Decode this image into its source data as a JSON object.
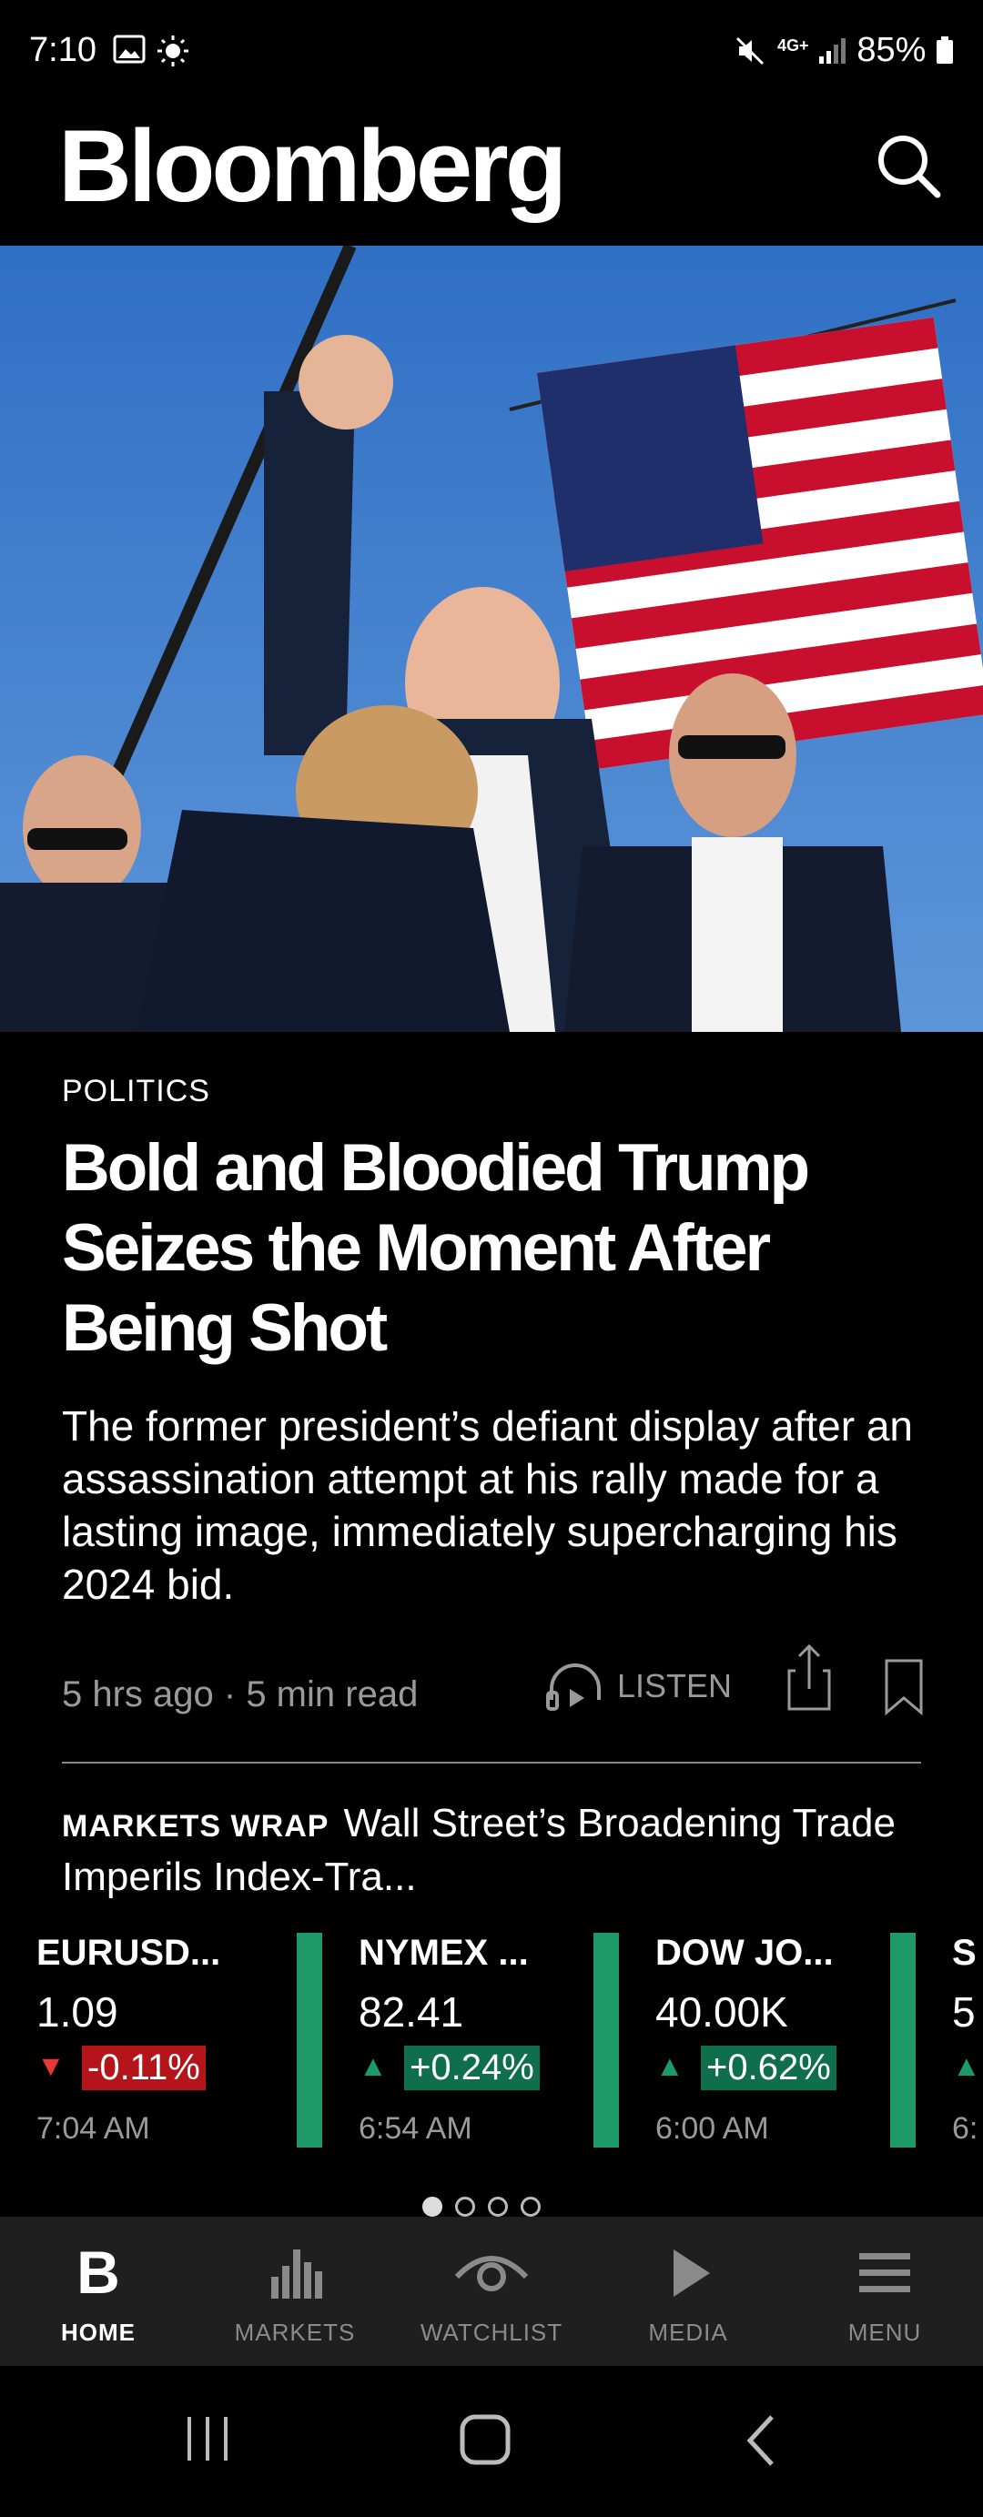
{
  "status_bar": {
    "time": "7:10",
    "battery": "85%",
    "network": "4G+"
  },
  "header": {
    "brand": "Bloomberg"
  },
  "article": {
    "category": "POLITICS",
    "headline": "Bold and Bloodied Trump Seizes the Moment After Being Shot",
    "summary": "The former president’s defiant display after an assassination attempt at his rally made for a lasting image, immediately supercharging his 2024 bid.",
    "meta": "5 hrs ago · 5 min read",
    "listen_label": "LISTEN"
  },
  "markets_wrap": {
    "tag": "MARKETS WRAP",
    "headline": "Wall Street’s Broadening Trade Imperils Index-Tra..."
  },
  "tickers": [
    {
      "name": "EURUSD...",
      "price": "1.09",
      "change": "-0.11%",
      "direction": "down",
      "time": "7:04 AM",
      "color": "#e53935"
    },
    {
      "name": "NYMEX ...",
      "price": "82.41",
      "change": "+0.24%",
      "direction": "up",
      "time": "6:54 AM",
      "color": "#1e9a6a"
    },
    {
      "name": "DOW JO...",
      "price": "40.00K",
      "change": "+0.62%",
      "direction": "up",
      "time": "6:00 AM",
      "color": "#1e9a6a"
    },
    {
      "name": "S",
      "price": "5",
      "change": "",
      "direction": "up",
      "time": "6:",
      "color": "#1e9a6a"
    }
  ],
  "pager": {
    "total": 4,
    "active": 1
  },
  "bottom_nav": [
    {
      "label": "HOME",
      "icon": "home-b-icon",
      "active": true
    },
    {
      "label": "MARKETS",
      "icon": "bar-chart-icon",
      "active": false
    },
    {
      "label": "WATCHLIST",
      "icon": "eye-icon",
      "active": false
    },
    {
      "label": "MEDIA",
      "icon": "play-icon",
      "active": false
    },
    {
      "label": "MENU",
      "icon": "hamburger-icon",
      "active": false
    }
  ],
  "colors": {
    "down_bg": "#b3151b",
    "up_bg": "#0f6e4b",
    "nav_bg": "#1f1f1f"
  }
}
